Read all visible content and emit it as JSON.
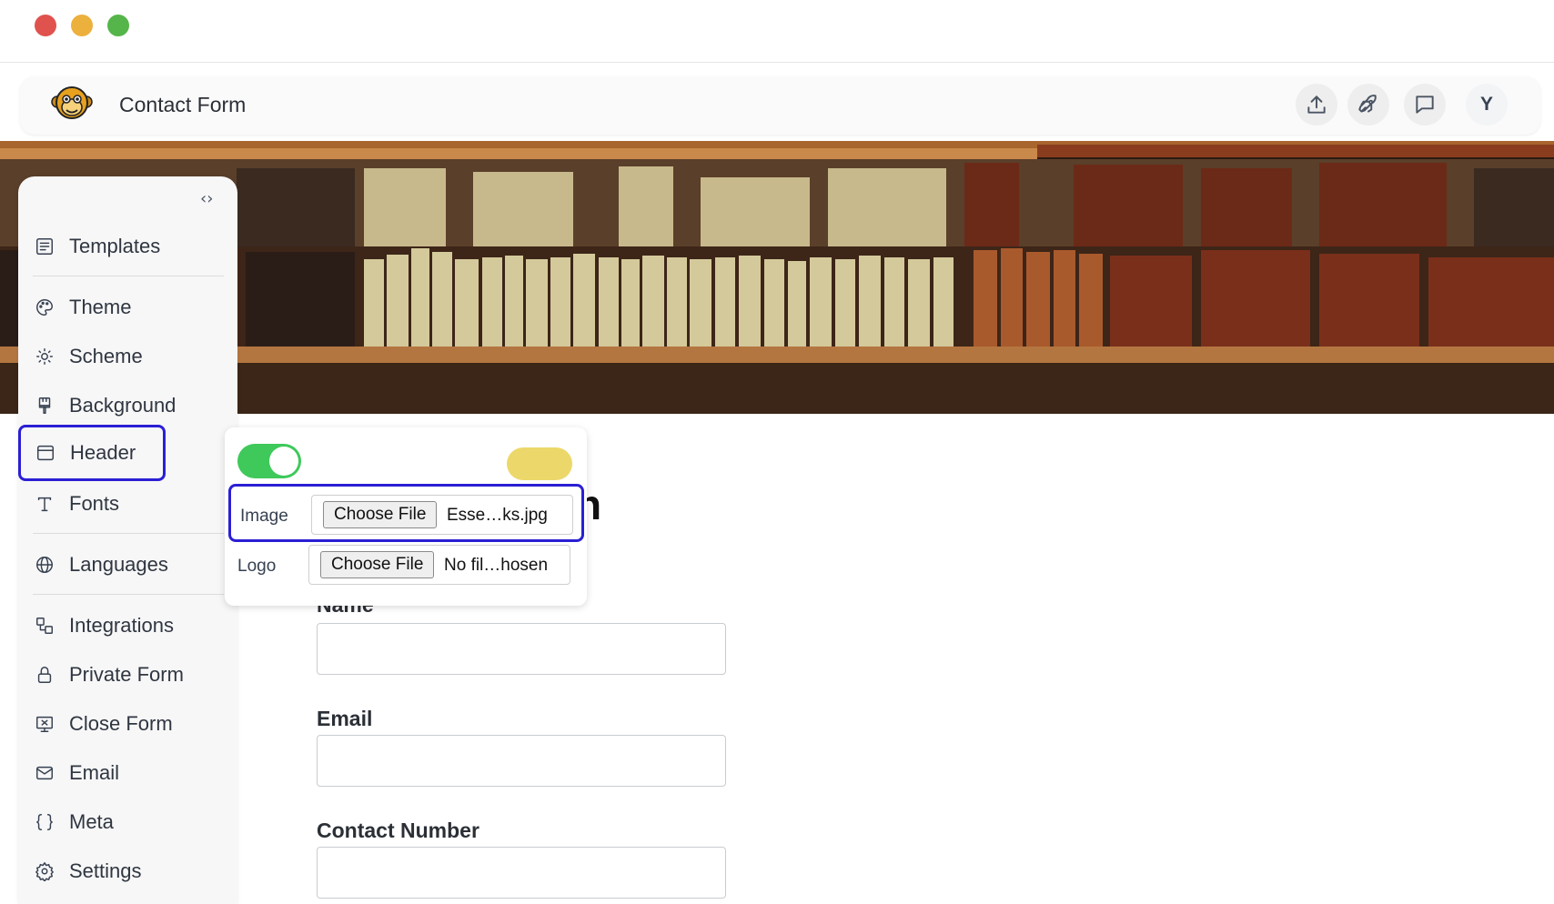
{
  "window": {
    "controls": [
      "close",
      "minimize",
      "zoom"
    ]
  },
  "topbar": {
    "logo_icon": "monkey-face-icon",
    "title": "Contact Form",
    "actions": [
      {
        "name": "upload-icon"
      },
      {
        "name": "rocket-icon"
      },
      {
        "name": "chat-icon"
      }
    ],
    "avatar_initial": "Y"
  },
  "sidebar": {
    "collapse_glyph": "‹›",
    "items": [
      {
        "label": "Templates",
        "icon": "template-list-icon"
      },
      {
        "label": "Theme",
        "icon": "palette-icon"
      },
      {
        "label": "Scheme",
        "icon": "sun-icon"
      },
      {
        "label": "Background",
        "icon": "paint-brush-icon"
      },
      {
        "label": "Header",
        "icon": "header-layout-icon",
        "active": true
      },
      {
        "label": "Fonts",
        "icon": "type-icon"
      },
      {
        "label": "Languages",
        "icon": "globe-icon"
      },
      {
        "label": "Integrations",
        "icon": "integrations-icon"
      },
      {
        "label": "Private Form",
        "icon": "lock-icon"
      },
      {
        "label": "Close Form",
        "icon": "close-form-icon"
      },
      {
        "label": "Email",
        "icon": "mail-icon"
      },
      {
        "label": "Meta",
        "icon": "braces-icon"
      },
      {
        "label": "Settings",
        "icon": "gear-icon"
      }
    ]
  },
  "header_panel": {
    "toggle_on": true,
    "accent_swatch": "#ecd86a",
    "image": {
      "label": "Image",
      "button": "Choose File",
      "filename": "Esse…ks.jpg"
    },
    "logo": {
      "label": "Logo",
      "button": "Choose File",
      "filename": "No fil…hosen"
    }
  },
  "form": {
    "heading_fragment": "n",
    "fields": [
      {
        "label": "Name"
      },
      {
        "label": "Email"
      },
      {
        "label": "Contact Number"
      }
    ]
  },
  "colors": {
    "highlight": "#2b1fd4",
    "toggle": "#3ec95a"
  }
}
